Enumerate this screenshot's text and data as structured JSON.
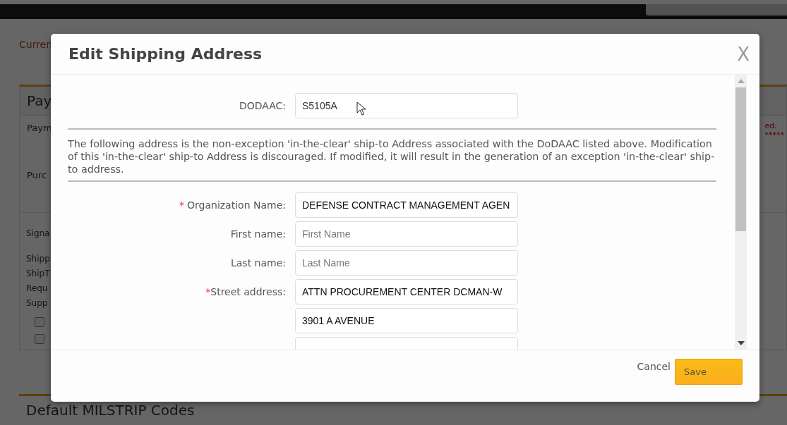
{
  "backdrop": {
    "breadcrumb": "Curren",
    "panel_title": "Pay",
    "rows": [
      "Paym",
      "Purc"
    ],
    "right_label": "ed:",
    "right_value": "*****",
    "section_rows": [
      "Signa",
      "Shipp",
      "ShipT",
      "Requ",
      "Supp"
    ],
    "checkboxes": [
      {
        "checked": false
      },
      {
        "checked": false
      }
    ],
    "lower_title": "Default MILSTRIP Codes"
  },
  "modal": {
    "title": "Edit Shipping Address",
    "close": "X",
    "dodaac": {
      "label": "DODAAC:",
      "value": "S5105A"
    },
    "notice": "The following address is the non-exception 'in-the-clear' ship-to Address associated with the DoDAAC listed above. Modification of this 'in-the-clear' ship-to Address is discouraged. If modified, it will result in the generation of an exception 'in-the-clear' ship-to address.",
    "fields": [
      {
        "kind": "labeled",
        "required_mark": "*",
        "label": "Organization Name:",
        "value": "DEFENSE CONTRACT MANAGEMENT AGEN"
      },
      {
        "kind": "labeled",
        "label": "First name:",
        "placeholder": "First Name"
      },
      {
        "kind": "labeled",
        "label": "Last name:",
        "placeholder": "Last Name"
      },
      {
        "kind": "labeled",
        "required_mark": "*",
        "label": "Street address:",
        "value": "ATTN PROCUREMENT CENTER DCMAN-W"
      },
      {
        "kind": "continuation",
        "value": "3901 A AVENUE"
      },
      {
        "kind": "continuation"
      }
    ],
    "buttons": {
      "cancel": "Cancel",
      "save": "Save"
    }
  }
}
